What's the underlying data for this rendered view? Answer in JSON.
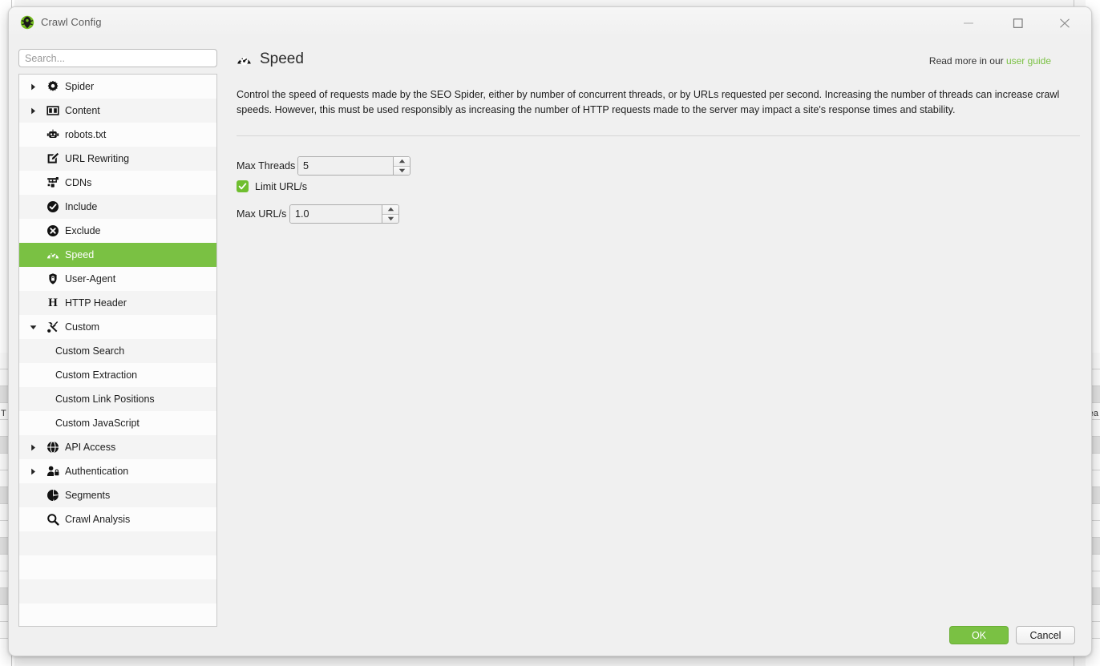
{
  "window": {
    "title": "Crawl Config",
    "app_icon": "spider-logo-icon",
    "minimize_label": "Minimize",
    "maximize_label": "Maximize",
    "close_label": "Close"
  },
  "sidebar": {
    "search_placeholder": "Search...",
    "search_value": "",
    "items": [
      {
        "label": "Spider",
        "icon": "gear-icon",
        "arrow": "right",
        "level": 0,
        "selected": false
      },
      {
        "label": "Content",
        "icon": "columns-icon",
        "arrow": "right",
        "level": 0,
        "selected": false
      },
      {
        "label": "robots.txt",
        "icon": "robot-icon",
        "arrow": "",
        "level": 0,
        "selected": false
      },
      {
        "label": "URL Rewriting",
        "icon": "edit-square-icon",
        "arrow": "",
        "level": 0,
        "selected": false
      },
      {
        "label": "CDNs",
        "icon": "network-icon",
        "arrow": "",
        "level": 0,
        "selected": false
      },
      {
        "label": "Include",
        "icon": "check-circle-icon",
        "arrow": "",
        "level": 0,
        "selected": false
      },
      {
        "label": "Exclude",
        "icon": "x-circle-icon",
        "arrow": "",
        "level": 0,
        "selected": false
      },
      {
        "label": "Speed",
        "icon": "speedometer-icon",
        "arrow": "",
        "level": 0,
        "selected": true
      },
      {
        "label": "User-Agent",
        "icon": "user-agent-icon",
        "arrow": "",
        "level": 0,
        "selected": false
      },
      {
        "label": "HTTP Header",
        "icon": "letter-h-icon",
        "arrow": "",
        "level": 0,
        "selected": false
      },
      {
        "label": "Custom",
        "icon": "tools-icon",
        "arrow": "down",
        "level": 0,
        "selected": false
      },
      {
        "label": "Custom Search",
        "icon": "",
        "arrow": "",
        "level": 1,
        "selected": false
      },
      {
        "label": "Custom Extraction",
        "icon": "",
        "arrow": "",
        "level": 1,
        "selected": false
      },
      {
        "label": "Custom Link Positions",
        "icon": "",
        "arrow": "",
        "level": 1,
        "selected": false
      },
      {
        "label": "Custom JavaScript",
        "icon": "",
        "arrow": "",
        "level": 1,
        "selected": false
      },
      {
        "label": "API Access",
        "icon": "globe-icon",
        "arrow": "right",
        "level": 0,
        "selected": false
      },
      {
        "label": "Authentication",
        "icon": "person-lock-icon",
        "arrow": "right",
        "level": 0,
        "selected": false
      },
      {
        "label": "Segments",
        "icon": "pie-chart-icon",
        "arrow": "",
        "level": 0,
        "selected": false
      },
      {
        "label": "Crawl Analysis",
        "icon": "magnifier-icon",
        "arrow": "",
        "level": 0,
        "selected": false
      }
    ]
  },
  "content": {
    "title": "Speed",
    "title_icon": "speedometer-icon",
    "guide_prefix": "Read more in our ",
    "guide_link": "user guide",
    "description": "Control the speed of requests made by the SEO Spider, either by number of concurrent threads, or by URLs requested per second. Increasing the number of threads can increase crawl speeds. However, this must be used responsibly as increasing the number of HTTP requests made to the server may impact a site's response times and stability.",
    "fields": {
      "max_threads_label": "Max Threads",
      "max_threads_value": "5",
      "limit_urls_label": "Limit URL/s",
      "limit_urls_checked": true,
      "max_urls_label": "Max URL/s",
      "max_urls_value": "1.0"
    }
  },
  "footer": {
    "ok_label": "OK",
    "cancel_label": "Cancel"
  },
  "theme": {
    "accent_green": "#7ac143",
    "checkbox_green": "#6fbe2f",
    "dialog_bg": "#f0f0f0",
    "sidebar_bg": "#fcfcfc"
  },
  "background": {
    "partial_text_left": "T",
    "partial_text_right": "ea"
  }
}
